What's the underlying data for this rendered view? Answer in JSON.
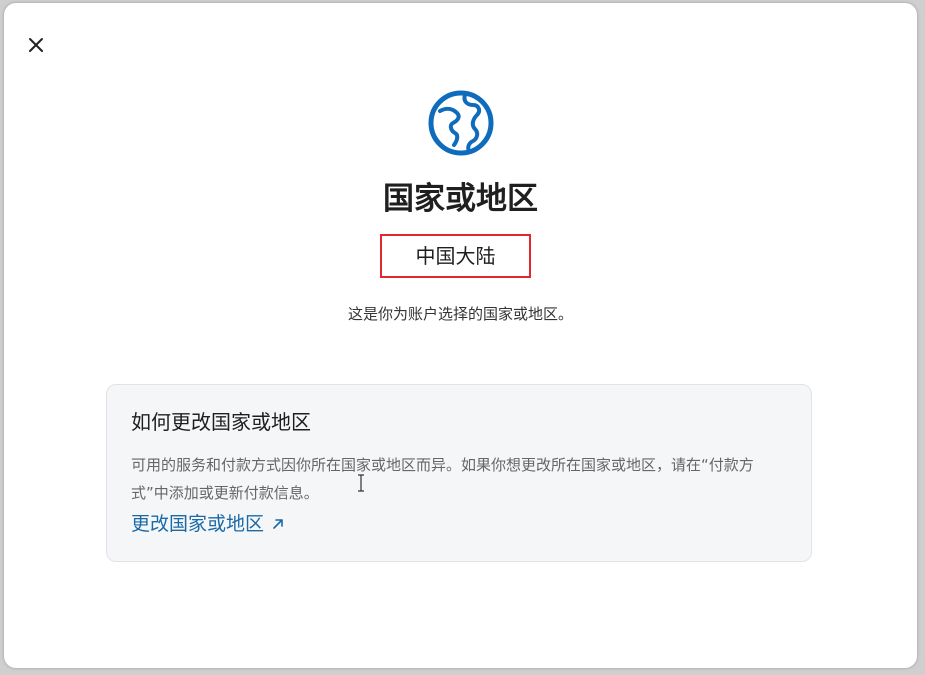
{
  "dialog": {
    "close_icon": "close-icon",
    "header_icon": "globe-icon",
    "title": "国家或地区",
    "selected_region": "中国大陆",
    "subtitle": "这是你为账户选择的国家或地区。",
    "highlight_color": "#e0282e"
  },
  "info_card": {
    "title": "如何更改国家或地区",
    "description": "可用的服务和付款方式因你所在国家或地区而异。如果你想更改所在国家或地区，请在“付款方式”中添加或更新付款信息。",
    "link_label": "更改国家或地区",
    "link_icon": "external-link-arrow-icon",
    "link_color": "#1a6aa8"
  },
  "accent_color": "#0f6cbd"
}
